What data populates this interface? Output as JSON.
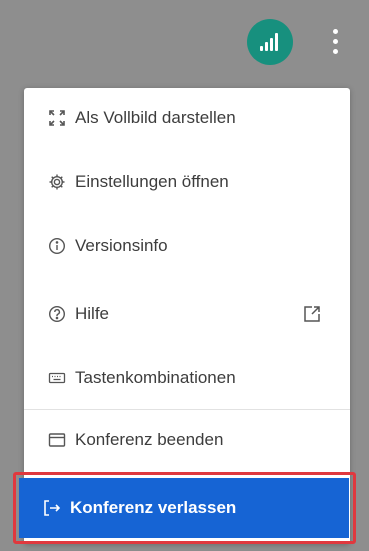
{
  "colors": {
    "backdrop": "#8e8e8e",
    "signal_button": "#17907e",
    "primary_action": "#1664d4",
    "highlight_border": "#e0383e"
  },
  "topbar": {
    "signal_icon": "signal-strength-icon",
    "more_icon": "more-vertical-icon"
  },
  "menu": {
    "items": [
      {
        "label": "Als Vollbild darstellen",
        "icon": "fullscreen-icon"
      },
      {
        "label": "Einstellungen öffnen",
        "icon": "gear-icon"
      },
      {
        "label": "Versionsinfo",
        "icon": "info-icon"
      },
      {
        "label": "Hilfe",
        "icon": "help-icon",
        "trailing_icon": "external-link-icon"
      },
      {
        "label": "Tastenkombinationen",
        "icon": "keyboard-icon"
      },
      {
        "label": "Konferenz beenden",
        "icon": "window-icon"
      }
    ],
    "leave": {
      "label": "Konferenz verlassen",
      "icon": "exit-icon"
    }
  }
}
